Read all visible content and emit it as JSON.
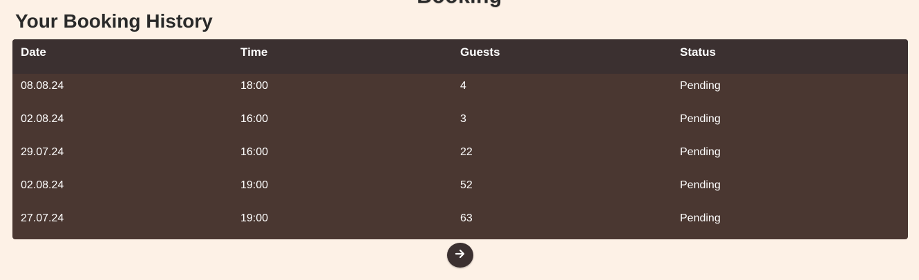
{
  "header": {
    "clipped_heading": "Booking",
    "title": "Your Booking History"
  },
  "table": {
    "columns": [
      "Date",
      "Time",
      "Guests",
      "Status"
    ],
    "rows": [
      [
        "08.08.24",
        "18:00",
        "4",
        "Pending"
      ],
      [
        "02.08.24",
        "16:00",
        "3",
        "Pending"
      ],
      [
        "29.07.24",
        "16:00",
        "22",
        "Pending"
      ],
      [
        "02.08.24",
        "19:00",
        "52",
        "Pending"
      ],
      [
        "27.07.24",
        "19:00",
        "63",
        "Pending"
      ]
    ]
  },
  "pagination": {
    "next_icon": "arrow-right-icon"
  },
  "colors": {
    "background": "#fdf1e6",
    "table_header": "#3b3030",
    "table_body": "#4a3731",
    "text_light": "#ffffff"
  }
}
